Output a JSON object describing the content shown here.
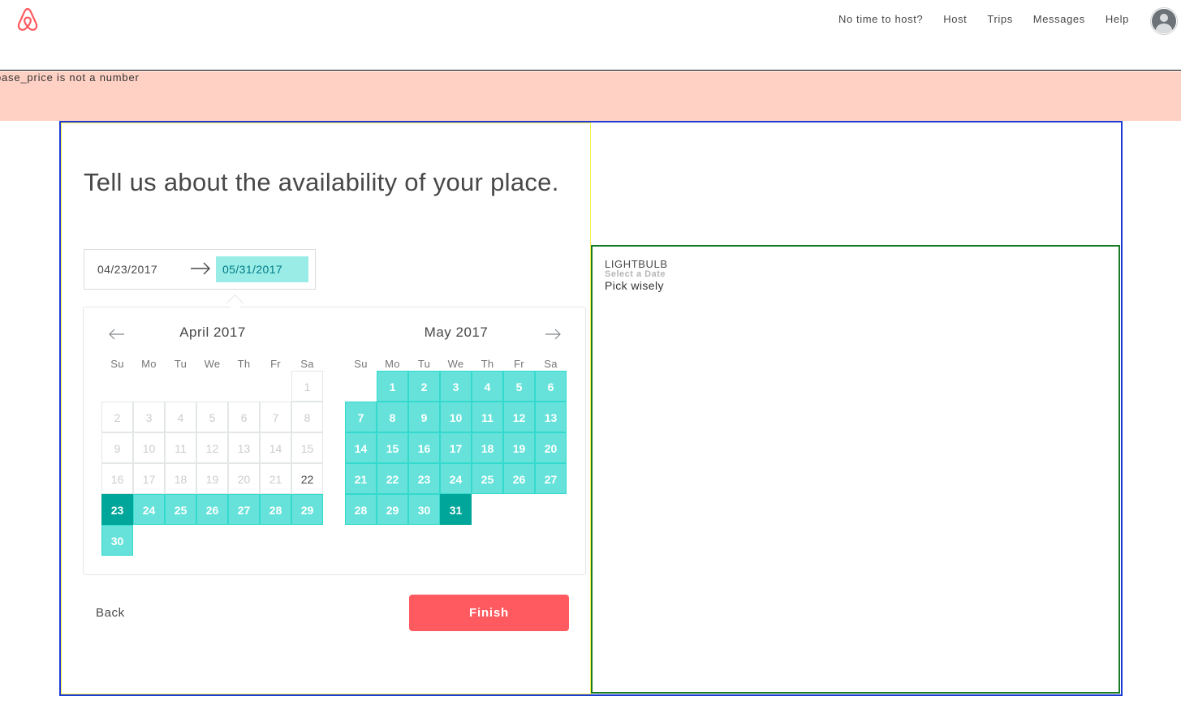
{
  "header": {
    "nav": [
      "No time to host?",
      "Host",
      "Trips",
      "Messages",
      "Help"
    ]
  },
  "error": {
    "message": "base_price is not a number"
  },
  "form": {
    "headline": "Tell us about the availability of your place.",
    "start_date": "04/23/2017",
    "end_date": "05/31/2017",
    "back_label": "Back",
    "finish_label": "Finish"
  },
  "calendar": {
    "weekdays": [
      "Su",
      "Mo",
      "Tu",
      "We",
      "Th",
      "Fr",
      "Sa"
    ],
    "months": [
      {
        "title": "April 2017",
        "first_weekday": 6,
        "days": 30,
        "blocked_through": 21,
        "selected_start": 23,
        "range_end": 30,
        "selected_end": null
      },
      {
        "title": "May 2017",
        "first_weekday": 1,
        "days": 31,
        "blocked_through": 0,
        "selected_start": null,
        "range_end": 31,
        "selected_end": 31
      }
    ]
  },
  "lightbulb": {
    "title": "LIGHTBULB",
    "subtitle": "Select a Date",
    "body": "Pick wisely"
  },
  "colors": {
    "brand": "#ff5a5f",
    "range": "#66e2da",
    "selected": "#00a699",
    "error_bg": "#ffd1c4"
  }
}
